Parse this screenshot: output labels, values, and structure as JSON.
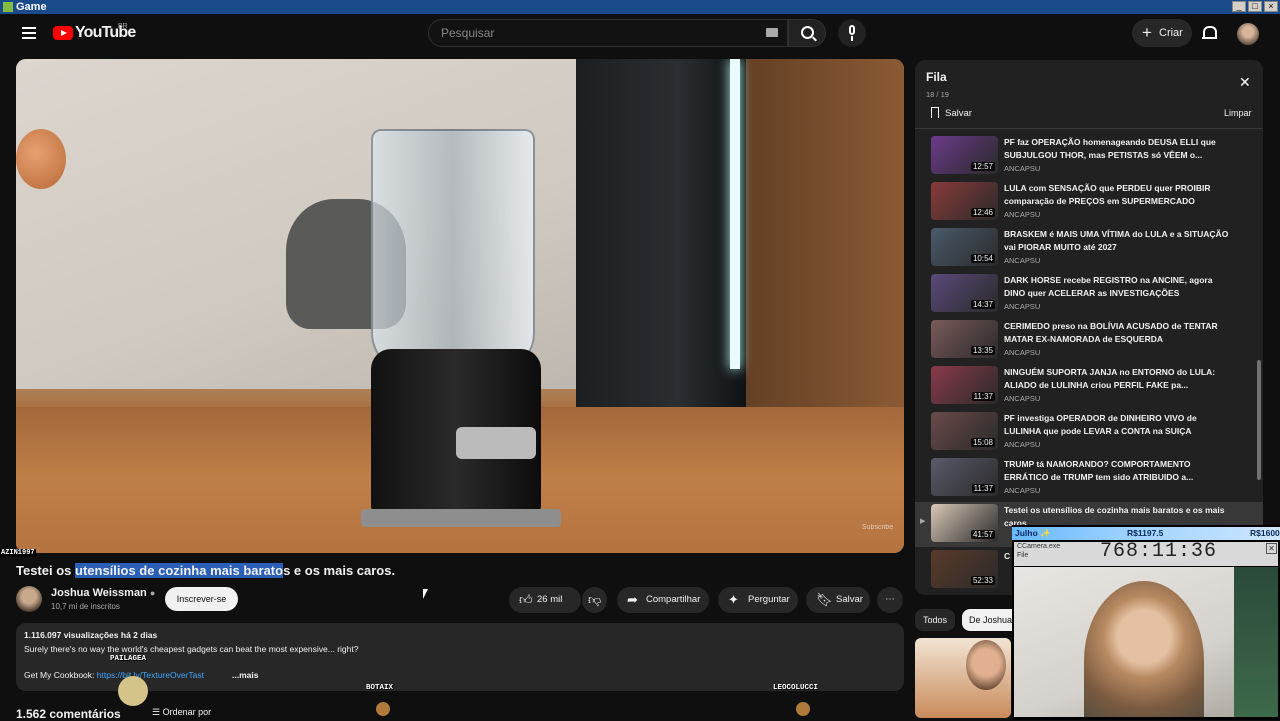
{
  "window": {
    "title": "Game"
  },
  "header": {
    "logo_text": "YouTube",
    "region": "BR",
    "search_placeholder": "Pesquisar",
    "create_label": "Criar"
  },
  "video": {
    "title_highlight": "utensílios de cozinha mais barato",
    "title_pre": "Testei os ",
    "title_post": "s e os mais caros.",
    "watermark": "Subscribe"
  },
  "channel": {
    "name": "Joshua Weissman",
    "verified_icon": "check-circle-icon",
    "subscribers": "10,7 mi de inscritos",
    "subscribe_label": "Inscrever-se"
  },
  "actions": {
    "likes": "26 mil",
    "share": "Compartilhar",
    "ask": "Perguntar",
    "save": "Salvar",
    "more": "⋯"
  },
  "description": {
    "views_date": "1.116.097 visualizações  há 2 dias",
    "text": "Surely there's no way the world's cheapest gadgets can beat the most expensive... right?",
    "cookbook_label": "Get My Cookbook: ",
    "cookbook_link": "https://bit.ly/TextureOverTast",
    "more_label": "...mais"
  },
  "comments": {
    "count": "1.562 comentários",
    "sort_label": "Ordenar por"
  },
  "queue": {
    "title": "Fila",
    "position": "18 / 19",
    "save_label": "Salvar",
    "clear_label": "Limpar",
    "items": [
      {
        "title": "PF faz OPERAÇÃO homenageando DEUSA ELLI que SUBJULGOU THOR, mas PETISTAS só VÊEM o...",
        "channel": "ANCAPSU",
        "duration": "12:57"
      },
      {
        "title": "LULA com SENSAÇÃO que PERDEU quer PROIBIR comparação de PREÇOS em SUPERMERCADO",
        "channel": "ANCAPSU",
        "duration": "12:46"
      },
      {
        "title": "BRASKEM é MAIS UMA VÍTIMA do LULA e a SITUAÇÃO vai PIORAR MUITO até 2027",
        "channel": "ANCAPSU",
        "duration": "10:54"
      },
      {
        "title": "DARK HORSE recebe REGISTRO na ANCINE, agora DINO quer ACELERAR as INVESTIGAÇÕES",
        "channel": "ANCAPSU",
        "duration": "14:37"
      },
      {
        "title": "CERIMEDO preso na BOLÍVIA ACUSADO de TENTAR MATAR EX-NAMORADA de ESQUERDA",
        "channel": "ANCAPSU",
        "duration": "13:35"
      },
      {
        "title": "NINGUÉM SUPORTA JANJA no ENTORNO do LULA: ALIADO de LULINHA criou PERFIL FAKE pa...",
        "channel": "ANCAPSU",
        "duration": "11:37"
      },
      {
        "title": "PF investiga OPERADOR de DINHEIRO VIVO de LULINHA que pode LEVAR a CONTA na SUIÇA",
        "channel": "ANCAPSU",
        "duration": "15:08"
      },
      {
        "title": "TRUMP tá NAMORANDO? COMPORTAMENTO ERRÁTICO de TRUMP tem sido ATRIBUIDO a...",
        "channel": "ANCAPSU",
        "duration": "11:37"
      },
      {
        "title": "Testei os utensílios de cozinha mais baratos e os mais caros",
        "channel": "",
        "duration": "41:57",
        "current": true,
        "play_icon": "▶"
      },
      {
        "title": "C",
        "channel": "",
        "duration": "52:33"
      }
    ]
  },
  "chips": {
    "all": "Todos",
    "from": "De Joshua"
  },
  "overlay": {
    "top_left_user": "AZIN1997",
    "nick1": "PAILAGEA",
    "nick2": "BOTAIX",
    "nick3": "LEOCOLUCCI"
  },
  "stream": {
    "user": "Julho ✨",
    "amount1": "R$1197.5",
    "amount2": "R$1600",
    "camera_label": "CCamera.exe",
    "camera_sub": "File",
    "timer": "768:11:36",
    "close": "✕"
  }
}
